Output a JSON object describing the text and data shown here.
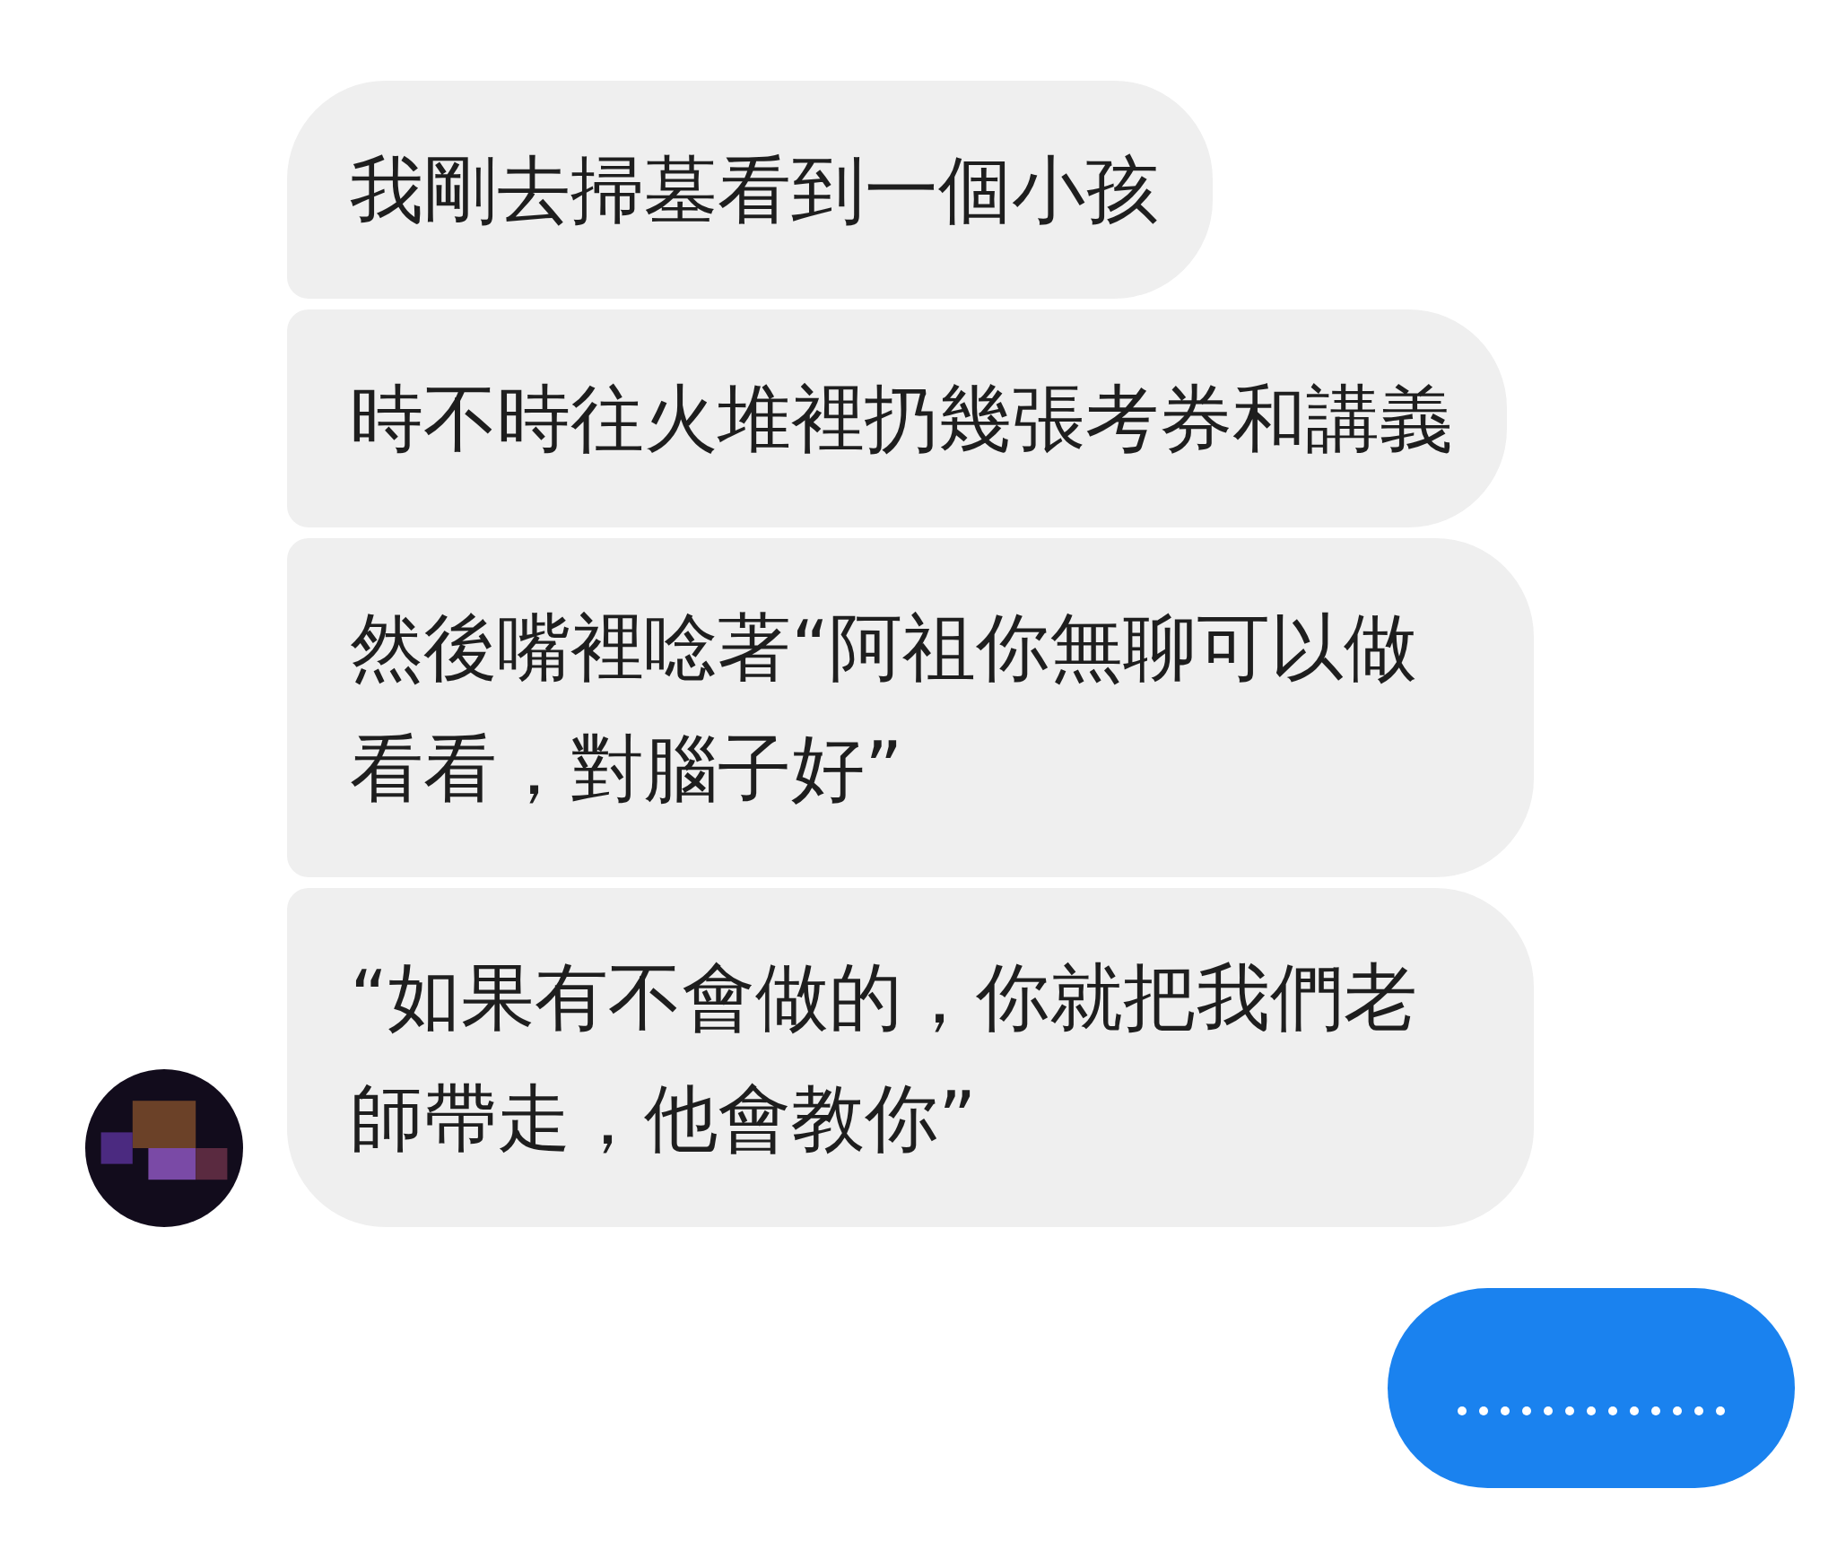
{
  "messages": [
    {
      "text": "我剛去掃墓看到一個小孩"
    },
    {
      "text": "時不時往火堆裡扔幾張考券和講義"
    },
    {
      "text": "然後嘴裡唸著“阿祖你無聊可以做看看，對腦子好”"
    },
    {
      "text": "“如果有不會做的，你就把我們老師帶走，他會教你”"
    }
  ]
}
